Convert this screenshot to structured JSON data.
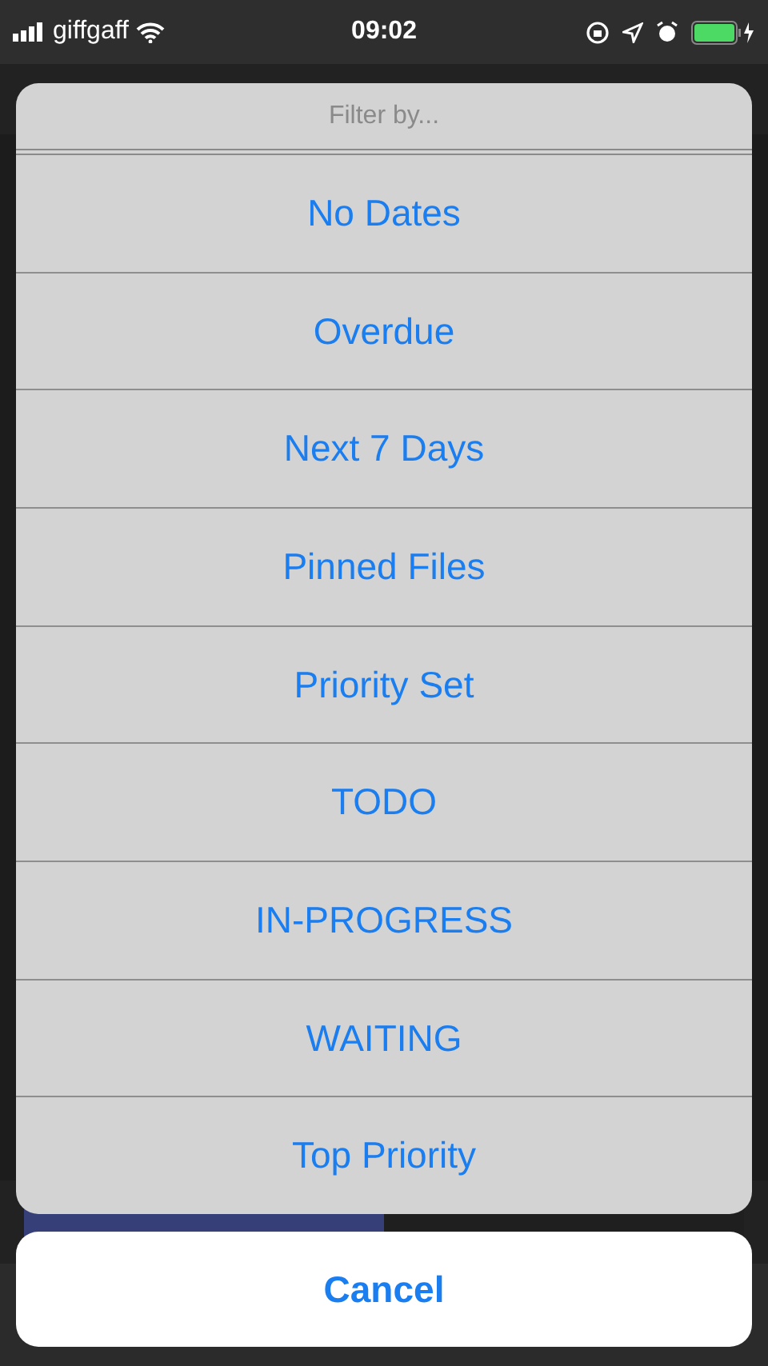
{
  "status_bar": {
    "carrier": "giffgaff",
    "time": "09:02"
  },
  "action_sheet": {
    "title": "Filter by...",
    "options": [
      "No Dates",
      "Overdue",
      "Next 7 Days",
      "Pinned Files",
      "Priority Set",
      "TODO",
      "IN-PROGRESS",
      "WAITING",
      "Top Priority"
    ],
    "cancel": "Cancel"
  }
}
